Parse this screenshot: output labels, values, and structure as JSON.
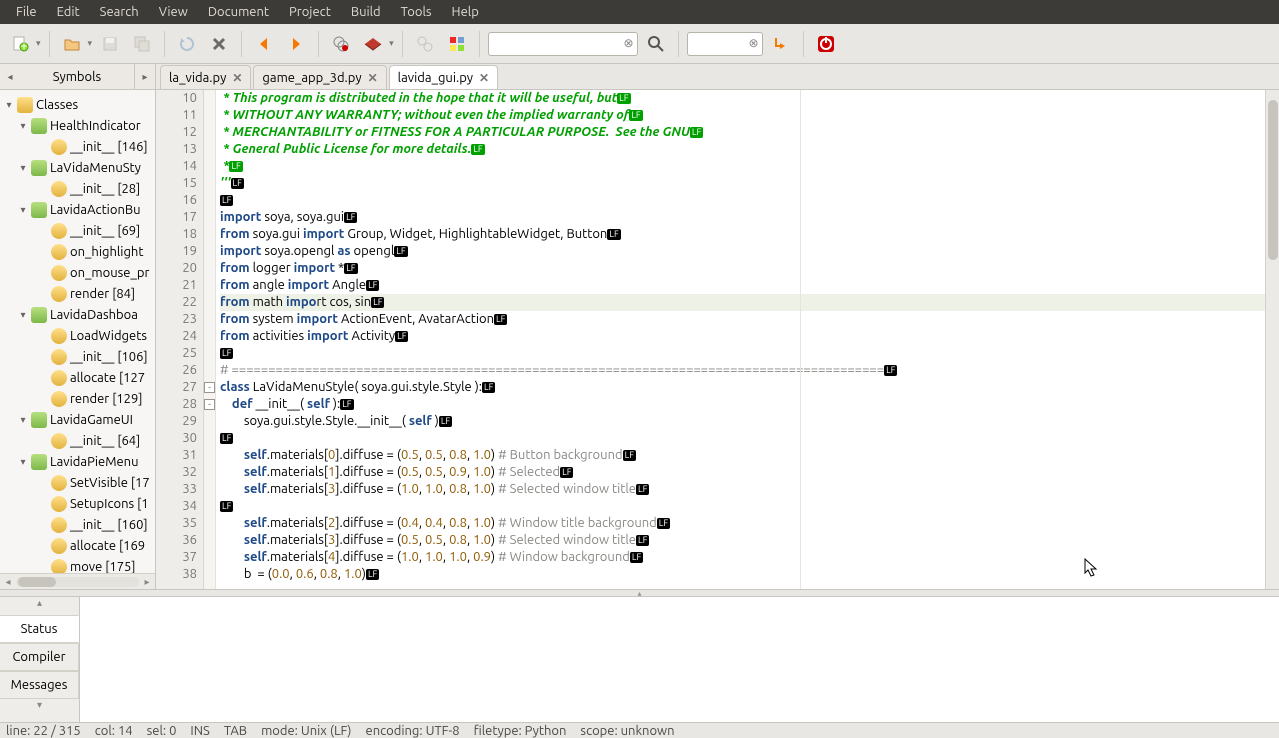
{
  "menu": [
    "File",
    "Edit",
    "Search",
    "View",
    "Document",
    "Project",
    "Build",
    "Tools",
    "Help"
  ],
  "sidebar": {
    "title": "Symbols",
    "root": "Classes",
    "items": [
      {
        "t": "sec",
        "tw": "▾",
        "lbl": "HealthIndicator",
        "l": 1
      },
      {
        "t": "fn",
        "tw": "",
        "lbl": "__init__  [146]",
        "l": 2
      },
      {
        "t": "sec",
        "tw": "▾",
        "lbl": "LaVidaMenuSty",
        "l": 1
      },
      {
        "t": "fn",
        "tw": "",
        "lbl": "__init__  [28]",
        "l": 2
      },
      {
        "t": "sec",
        "tw": "▾",
        "lbl": "LavidaActionBu",
        "l": 1
      },
      {
        "t": "fn",
        "tw": "",
        "lbl": "__init__  [69]",
        "l": 2
      },
      {
        "t": "fn",
        "tw": "",
        "lbl": "on_highlight",
        "l": 2
      },
      {
        "t": "fn",
        "tw": "",
        "lbl": "on_mouse_pr",
        "l": 2
      },
      {
        "t": "fn",
        "tw": "",
        "lbl": "render [84]",
        "l": 2
      },
      {
        "t": "sec",
        "tw": "▾",
        "lbl": "LavidaDashboa",
        "l": 1
      },
      {
        "t": "fn",
        "tw": "",
        "lbl": "LoadWidgets",
        "l": 2
      },
      {
        "t": "fn",
        "tw": "",
        "lbl": "__init__  [106]",
        "l": 2
      },
      {
        "t": "fn",
        "tw": "",
        "lbl": "allocate [127",
        "l": 2
      },
      {
        "t": "fn",
        "tw": "",
        "lbl": "render [129]",
        "l": 2
      },
      {
        "t": "sec",
        "tw": "▾",
        "lbl": "LavidaGameUI",
        "l": 1
      },
      {
        "t": "fn",
        "tw": "",
        "lbl": "__init__  [64]",
        "l": 2
      },
      {
        "t": "sec",
        "tw": "▾",
        "lbl": "LavidaPieMenu",
        "l": 1
      },
      {
        "t": "fn",
        "tw": "",
        "lbl": "SetVisible [17",
        "l": 2
      },
      {
        "t": "fn",
        "tw": "",
        "lbl": "SetupIcons [1",
        "l": 2
      },
      {
        "t": "fn",
        "tw": "",
        "lbl": "__init__  [160]",
        "l": 2
      },
      {
        "t": "fn",
        "tw": "",
        "lbl": "allocate [169",
        "l": 2
      },
      {
        "t": "fn",
        "tw": "",
        "lbl": "move [175]",
        "l": 2
      }
    ]
  },
  "tabs": [
    {
      "label": "la_vida.py",
      "active": false
    },
    {
      "label": "game_app_3d.py",
      "active": false
    },
    {
      "label": "lavida_gui.py",
      "active": true
    }
  ],
  "code": {
    "start": 10,
    "lines": [
      {
        "html": " <span class='cm1'>* This program is distributed in the hope that it will be useful, but</span><span class='lfg'>LF</span>"
      },
      {
        "html": " <span class='cm1'>* WITHOUT ANY WARRANTY; without even the implied warranty of</span><span class='lfg'>LF</span>"
      },
      {
        "html": " <span class='cm1'>* MERCHANTABILITY or FITNESS FOR A PARTICULAR PURPOSE.  See the GNU</span><span class='lfg'>LF</span>"
      },
      {
        "html": " <span class='cm1'>* General Public License for more details.</span><span class='lfg'>LF</span>"
      },
      {
        "html": " <span class='cm1'>*</span><span class='lfg'>LF</span>"
      },
      {
        "html": "<span class='cm1'>'''</span><span class='lf'>LF</span>"
      },
      {
        "html": "<span class='lf'>LF</span>"
      },
      {
        "html": "<span class='kw'>import</span> soya, soya.gui<span class='lf'>LF</span>"
      },
      {
        "html": "<span class='kw'>from</span> soya.gui <span class='kw'>import</span> Group, Widget, HighlightableWidget, Button<span class='lf'>LF</span>"
      },
      {
        "html": "<span class='kw'>import</span> soya.opengl <span class='kw'>as</span> opengl<span class='lf'>LF</span>"
      },
      {
        "html": "<span class='kw'>from</span> logger <span class='kw'>import</span> *<span class='lf'>LF</span>"
      },
      {
        "html": "<span class='kw'>from</span> angle <span class='kw'>import</span> Angle<span class='lf'>LF</span>"
      },
      {
        "html": "<span class='kw'>from</span> math <span class='kw'>impo</span>rt cos, sin<span class='lf'>LF</span>",
        "hl": true
      },
      {
        "html": "<span class='kw'>from</span> system <span class='kw'>import</span> ActionEvent, AvatarAction<span class='lf'>LF</span>"
      },
      {
        "html": "<span class='kw'>from</span> activities <span class='kw'>import</span> Activity<span class='lf'>LF</span>"
      },
      {
        "html": "<span class='lf'>LF</span>"
      },
      {
        "html": "<span class='cm2'># =========================================================================================</span><span class='lf'>LF</span>"
      },
      {
        "html": "<span class='kw'>class</span> LaVidaMenuStyle( soya.gui.style.Style ):<span class='lf'>LF</span>",
        "fold": "-"
      },
      {
        "html": "    <span class='kw'>def</span> __init__( <span class='kw'>self</span> ):<span class='lf'>LF</span>",
        "fold": "-"
      },
      {
        "html": "        soya.gui.style.Style.__init__( <span class='kw'>self</span> )<span class='lf'>LF</span>"
      },
      {
        "html": "<span class='lf'>LF</span>"
      },
      {
        "html": "        <span class='kw'>self</span>.materials[<span class='num'>0</span>].diffuse = (<span class='num'>0.5</span>, <span class='num'>0.5</span>, <span class='num'>0.8</span>, <span class='num'>1.0</span>) <span class='cm2'># Button background</span><span class='lf'>LF</span>"
      },
      {
        "html": "        <span class='kw'>self</span>.materials[<span class='num'>1</span>].diffuse = (<span class='num'>0.5</span>, <span class='num'>0.5</span>, <span class='num'>0.9</span>, <span class='num'>1.0</span>) <span class='cm2'># Selected</span><span class='lf'>LF</span>"
      },
      {
        "html": "        <span class='kw'>self</span>.materials[<span class='num'>3</span>].diffuse = (<span class='num'>1.0</span>, <span class='num'>1.0</span>, <span class='num'>0.8</span>, <span class='num'>1.0</span>) <span class='cm2'># Selected window title</span><span class='lf'>LF</span>"
      },
      {
        "html": "<span class='lf'>LF</span>"
      },
      {
        "html": "        <span class='kw'>self</span>.materials[<span class='num'>2</span>].diffuse = (<span class='num'>0.4</span>, <span class='num'>0.4</span>, <span class='num'>0.8</span>, <span class='num'>1.0</span>) <span class='cm2'># Window title background</span><span class='lf'>LF</span>"
      },
      {
        "html": "        <span class='kw'>self</span>.materials[<span class='num'>3</span>].diffuse = (<span class='num'>0.5</span>, <span class='num'>0.5</span>, <span class='num'>0.8</span>, <span class='num'>1.0</span>) <span class='cm2'># Selected window title</span><span class='lf'>LF</span>"
      },
      {
        "html": "        <span class='kw'>self</span>.materials[<span class='num'>4</span>].diffuse = (<span class='num'>1.0</span>, <span class='num'>1.0</span>, <span class='num'>1.0</span>, <span class='num'>0.9</span>) <span class='cm2'># Window background</span><span class='lf'>LF</span>"
      },
      {
        "html": "        b  = (<span class='num'>0.0</span>, <span class='num'>0.6</span>, <span class='num'>0.8</span>, <span class='num'>1.0</span>)<span class='lf'>LF</span>"
      }
    ]
  },
  "msgTabs": [
    "Status",
    "Compiler",
    "Messages"
  ],
  "msgActive": 0,
  "status": {
    "line": "line: 22 / 315",
    "col": "col: 14",
    "sel": "sel: 0",
    "ins": "INS",
    "tab": "TAB",
    "mode": "mode: Unix (LF)",
    "enc": "encoding: UTF-8",
    "ft": "filetype: Python",
    "scope": "scope: unknown"
  }
}
